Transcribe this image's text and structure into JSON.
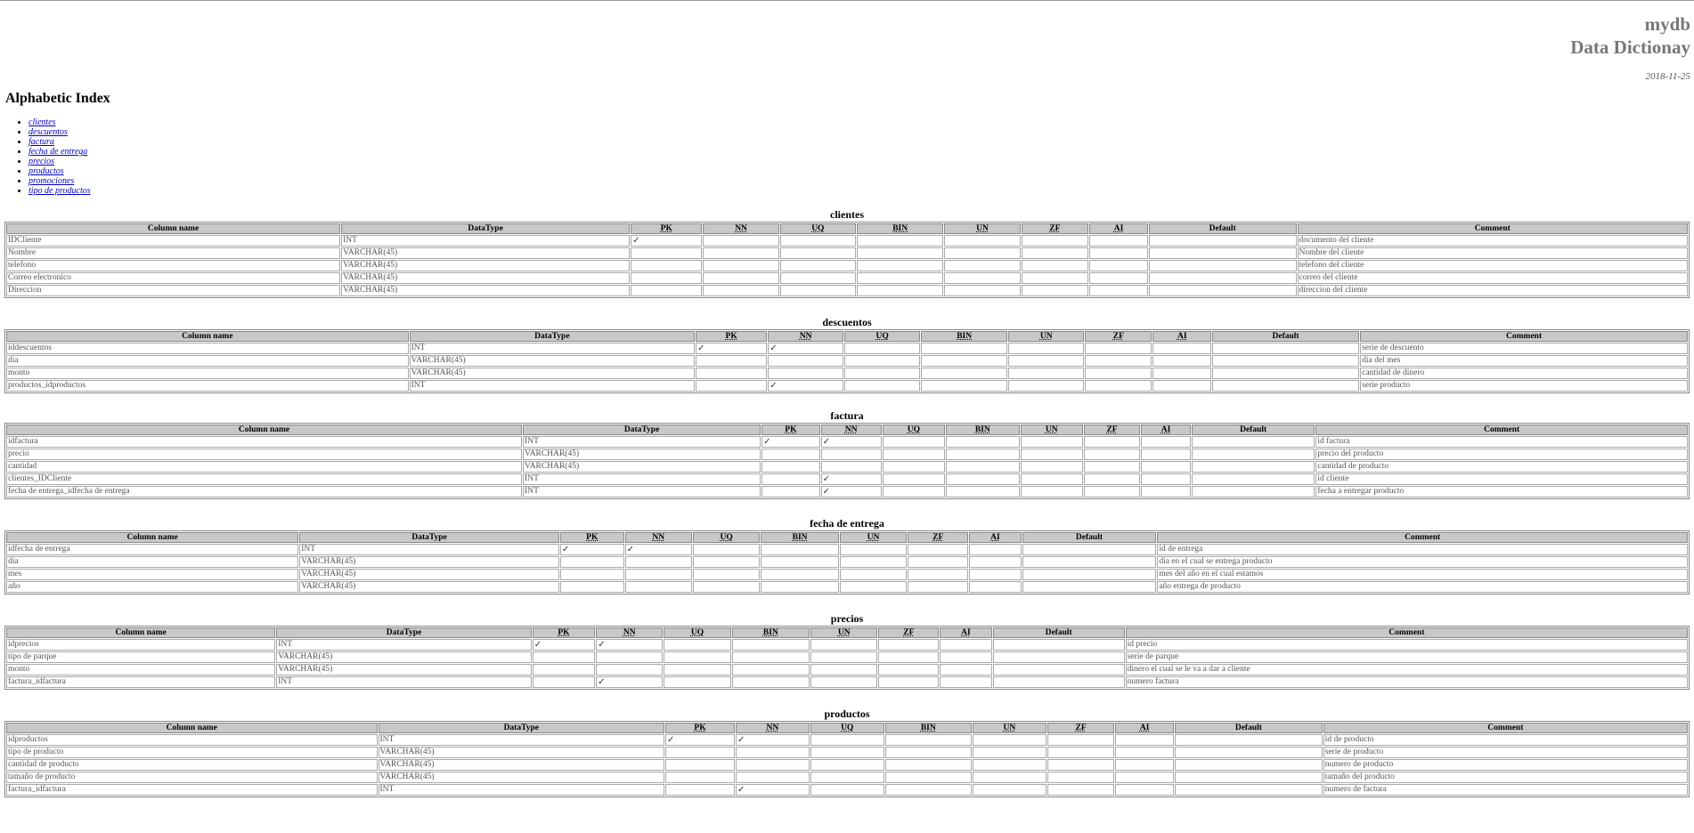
{
  "header": {
    "db_name": "mydb",
    "doc_title": "Data Dictionay",
    "date": "2018-11-25"
  },
  "index": {
    "title": "Alphabetic Index",
    "items": [
      "clientes",
      "descuentos",
      "factura",
      "fecha de entrega",
      "precios",
      "productos",
      "promociones",
      "tipo de productos"
    ]
  },
  "columns": [
    "Column name",
    "DataType",
    "PK",
    "NN",
    "UQ",
    "BIN",
    "UN",
    "ZF",
    "AI",
    "Default",
    "Comment"
  ],
  "check_mark": "✓",
  "tables": [
    {
      "name": "clientes",
      "rows": [
        {
          "col": "IDCliente",
          "type": "INT",
          "pk": true,
          "nn": false,
          "comment": "documento del cliente"
        },
        {
          "col": "Nombre",
          "type": "VARCHAR(45)",
          "pk": false,
          "nn": false,
          "comment": "Nombre del cliente"
        },
        {
          "col": "telefono",
          "type": "VARCHAR(45)",
          "pk": false,
          "nn": false,
          "comment": "telefono del cliente"
        },
        {
          "col": "Correo electronico",
          "type": "VARCHAR(45)",
          "pk": false,
          "nn": false,
          "comment": "correo del cliente"
        },
        {
          "col": "Direccion",
          "type": "VARCHAR(45)",
          "pk": false,
          "nn": false,
          "comment": "direccion del cliente"
        }
      ]
    },
    {
      "name": "descuentos",
      "rows": [
        {
          "col": "iddescuentos",
          "type": "INT",
          "pk": true,
          "nn": true,
          "comment": "serie de descuento"
        },
        {
          "col": "dia",
          "type": "VARCHAR(45)",
          "pk": false,
          "nn": false,
          "comment": "dia del mes"
        },
        {
          "col": "monto",
          "type": "VARCHAR(45)",
          "pk": false,
          "nn": false,
          "comment": "cantidad de dinero"
        },
        {
          "col": "productos_idproductos",
          "type": "INT",
          "pk": false,
          "nn": true,
          "comment": "serie producto"
        }
      ]
    },
    {
      "name": "factura",
      "rows": [
        {
          "col": "idfactura",
          "type": "INT",
          "pk": true,
          "nn": true,
          "comment": "id factura"
        },
        {
          "col": "precio",
          "type": "VARCHAR(45)",
          "pk": false,
          "nn": false,
          "comment": "precio del producto"
        },
        {
          "col": "cantidad",
          "type": "VARCHAR(45)",
          "pk": false,
          "nn": false,
          "comment": "cantidad de producto"
        },
        {
          "col": "clientes_IDCliente",
          "type": "INT",
          "pk": false,
          "nn": true,
          "comment": "id cliente"
        },
        {
          "col": "fecha de entrega_idfecha de entrega",
          "type": "INT",
          "pk": false,
          "nn": true,
          "comment": "fecha a entregar producto"
        }
      ]
    },
    {
      "name": "fecha de entrega",
      "rows": [
        {
          "col": "idfecha de entrega",
          "type": "INT",
          "pk": true,
          "nn": true,
          "comment": "id de entrega"
        },
        {
          "col": "dia",
          "type": "VARCHAR(45)",
          "pk": false,
          "nn": false,
          "comment": "dia en el cual se entrega producto"
        },
        {
          "col": "mes",
          "type": "VARCHAR(45)",
          "pk": false,
          "nn": false,
          "comment": "mes del año en el cual estamos"
        },
        {
          "col": "año",
          "type": "VARCHAR(45)",
          "pk": false,
          "nn": false,
          "comment": "año entrega de producto"
        }
      ]
    },
    {
      "name": "precios",
      "rows": [
        {
          "col": "idprecios",
          "type": "INT",
          "pk": true,
          "nn": true,
          "comment": "id precio"
        },
        {
          "col": "tipo de parque",
          "type": "VARCHAR(45)",
          "pk": false,
          "nn": false,
          "comment": "serie de parque"
        },
        {
          "col": "monto",
          "type": "VARCHAR(45)",
          "pk": false,
          "nn": false,
          "comment": "dinero el cual se le va a dar a cliente"
        },
        {
          "col": "factura_idfactura",
          "type": "INT",
          "pk": false,
          "nn": true,
          "comment": "numero factura"
        }
      ]
    },
    {
      "name": "productos",
      "rows": [
        {
          "col": "idproductos",
          "type": "INT",
          "pk": true,
          "nn": true,
          "comment": "id de producto"
        },
        {
          "col": "tipo de producto",
          "type": "VARCHAR(45)",
          "pk": false,
          "nn": false,
          "comment": "serie de producto"
        },
        {
          "col": "cantidad de producto",
          "type": "VARCHAR(45)",
          "pk": false,
          "nn": false,
          "comment": "numero de producto"
        },
        {
          "col": "tamaño de producto",
          "type": "VARCHAR(45)",
          "pk": false,
          "nn": false,
          "comment": "tamaño del producto"
        },
        {
          "col": "factura_idfactura",
          "type": "INT",
          "pk": false,
          "nn": true,
          "comment": "numero de factura"
        }
      ]
    }
  ]
}
